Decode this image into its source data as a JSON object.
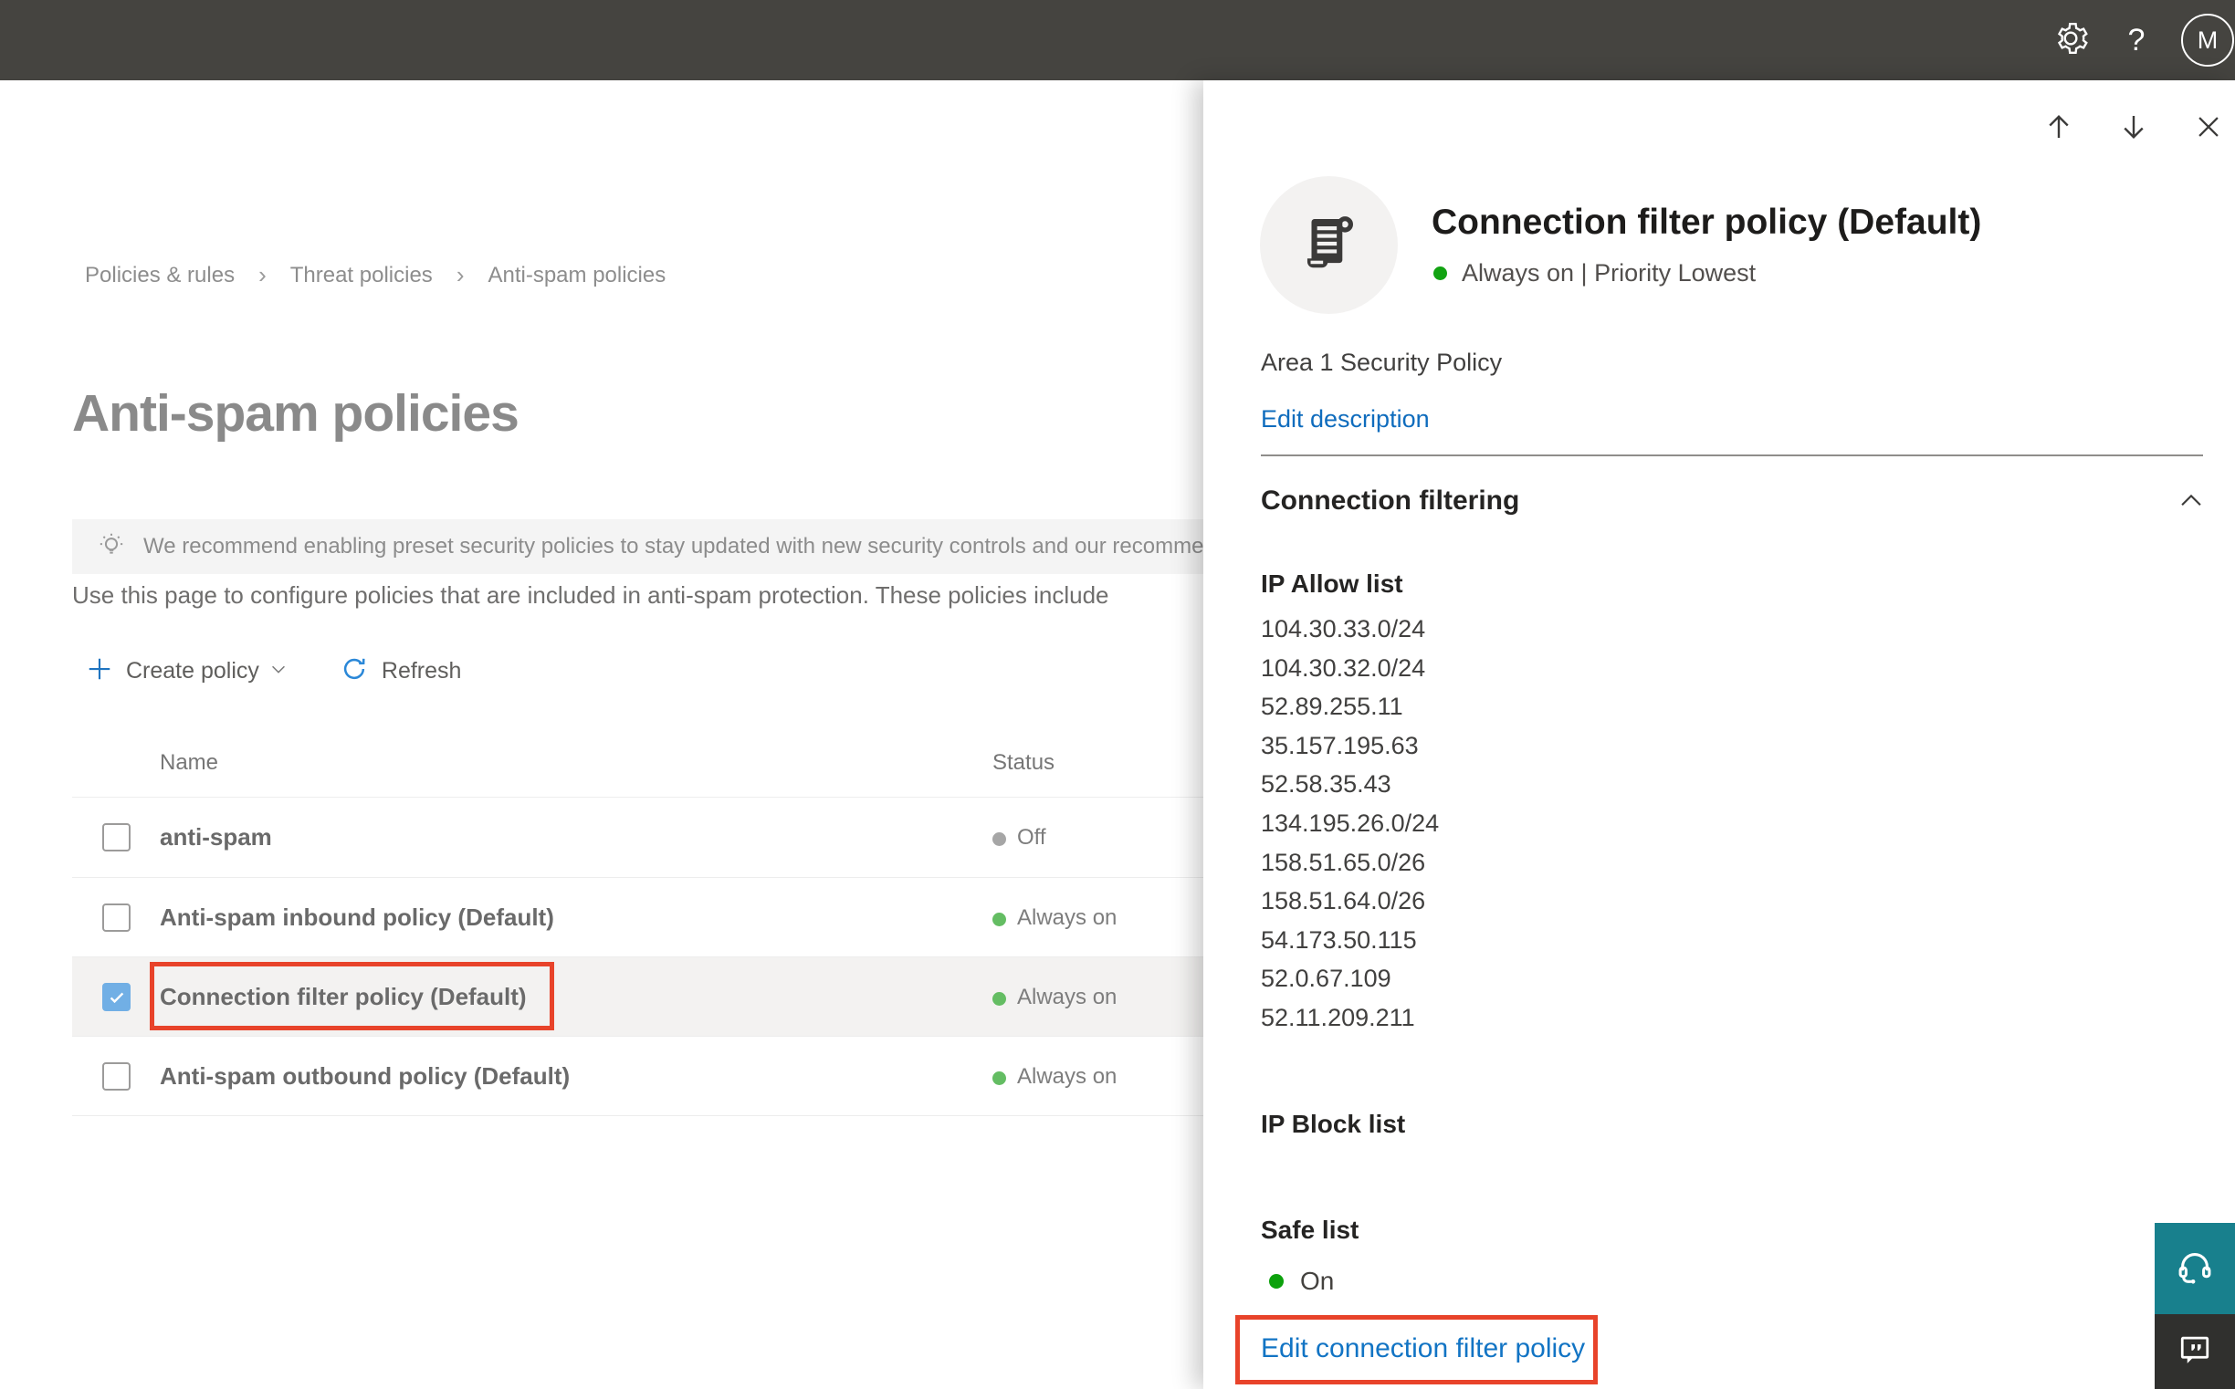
{
  "topbar": {
    "help_label": "?",
    "avatar_initial": "M"
  },
  "breadcrumb": {
    "items": [
      "Policies & rules",
      "Threat policies",
      "Anti-spam policies"
    ],
    "separator": "›"
  },
  "page": {
    "title": "Anti-spam policies",
    "banner_text": "We recommend enabling preset security policies to stay updated with new security controls and our recomme",
    "description": "Use this page to configure policies that are included in anti-spam protection. These policies include"
  },
  "toolbar": {
    "create_label": "Create policy",
    "refresh_label": "Refresh"
  },
  "table": {
    "columns": [
      "Name",
      "Status"
    ],
    "rows": [
      {
        "name": "anti-spam",
        "status": "Off"
      },
      {
        "name": "Anti-spam inbound policy (Default)",
        "status": "Always on"
      },
      {
        "name": "Connection filter policy (Default)",
        "status": "Always on"
      },
      {
        "name": "Anti-spam outbound policy (Default)",
        "status": "Always on"
      }
    ]
  },
  "flyout": {
    "title": "Connection filter policy (Default)",
    "status_line": "Always on | Priority Lowest",
    "description": "Area 1 Security Policy",
    "edit_description_label": "Edit description",
    "section_title": "Connection filtering",
    "ip_allow_label": "IP Allow list",
    "ip_allow": [
      "104.30.33.0/24",
      "104.30.32.0/24",
      "52.89.255.11",
      "35.157.195.63",
      "52.58.35.43",
      "134.195.26.0/24",
      "158.51.65.0/26",
      "158.51.64.0/26",
      "54.173.50.115",
      "52.0.67.109",
      "52.11.209.211"
    ],
    "ip_block_label": "IP Block list",
    "safe_list_label": "Safe list",
    "safe_list_status": "On",
    "edit_link_label": "Edit connection filter policy"
  },
  "colors": {
    "topbar_bg": "#454440",
    "accent_blue": "#0f6cbd",
    "status_on_green": "#64bd63",
    "status_bright_green": "#0ca10c",
    "status_off_gray": "#a6a6a6",
    "annotation_red": "#e8432a",
    "checkbox_checked_blue": "#71afe5",
    "selected_row_bg": "#f3f2f1",
    "support_teal": "#18808d",
    "feedback_dark": "#30302e"
  },
  "icons": {
    "topbar": [
      "gear-icon",
      "help-icon",
      "avatar"
    ],
    "toolbar": [
      "plus-icon",
      "chevron-down-icon",
      "refresh-icon"
    ],
    "banner": [
      "lightbulb-icon"
    ],
    "flyout": [
      "arrow-up-icon",
      "arrow-down-icon",
      "close-icon",
      "policy-scroll-icon",
      "chevron-up-icon"
    ],
    "corner": [
      "headset-icon",
      "feedback-chat-icon"
    ]
  }
}
